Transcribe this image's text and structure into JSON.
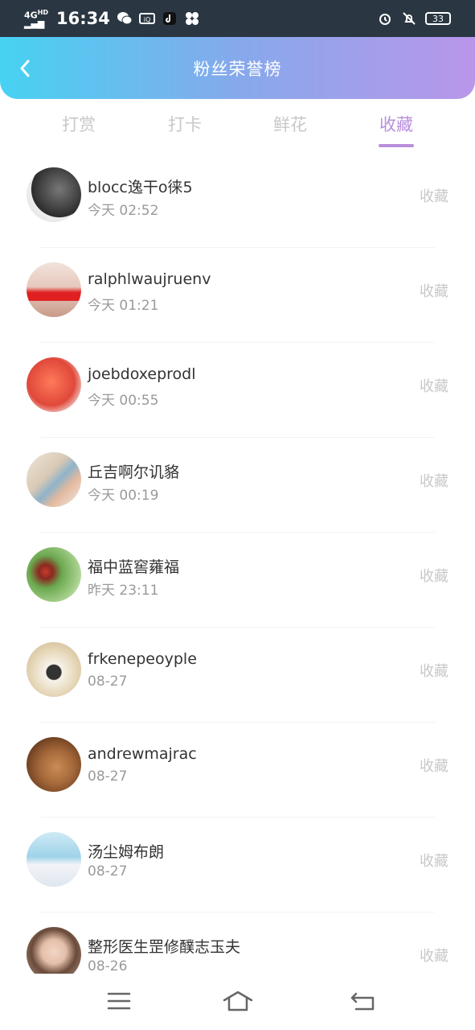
{
  "status_bar": {
    "network": "4G HD",
    "time": "16:34",
    "battery": "33"
  },
  "header": {
    "title": "粉丝荣誉榜"
  },
  "tabs": [
    {
      "label": "打赏",
      "active": false
    },
    {
      "label": "打卡",
      "active": false
    },
    {
      "label": "鲜花",
      "active": false
    },
    {
      "label": "收藏",
      "active": true
    }
  ],
  "list": [
    {
      "name": "blocc逸干o徕5",
      "time": "今天 02:52",
      "action": "收藏",
      "avatar_color": "#2c2c2c"
    },
    {
      "name": "ralphlwaujruenv",
      "time": "今天 01:21",
      "action": "收藏",
      "avatar_color": "#d84a4a"
    },
    {
      "name": "joebdoxeprodl",
      "time": "今天 00:55",
      "action": "收藏",
      "avatar_color": "#e0483a"
    },
    {
      "name": "丘吉啊尔讥貉",
      "time": "今天 00:19",
      "action": "收藏",
      "avatar_color": "#d9c9b4"
    },
    {
      "name": "福中蓝窖蕹福",
      "time": "昨天 23:11",
      "action": "收藏",
      "avatar_color": "#6aa84f"
    },
    {
      "name": "frkenepeoyple",
      "time": "08-27",
      "action": "收藏",
      "avatar_color": "#c9b28a"
    },
    {
      "name": "andrewmajrac",
      "time": "08-27",
      "action": "收藏",
      "avatar_color": "#a5683a"
    },
    {
      "name": "汤尘姆布朗",
      "time": "08-27",
      "action": "收藏",
      "avatar_color": "#9fd3e8"
    },
    {
      "name": "整形医生罡修醭志玉夫",
      "time": "08-26",
      "action": "收藏",
      "avatar_color": "#b8a08c"
    }
  ],
  "nav": {
    "menu": "menu-icon",
    "home": "home-icon",
    "back": "back-icon"
  }
}
